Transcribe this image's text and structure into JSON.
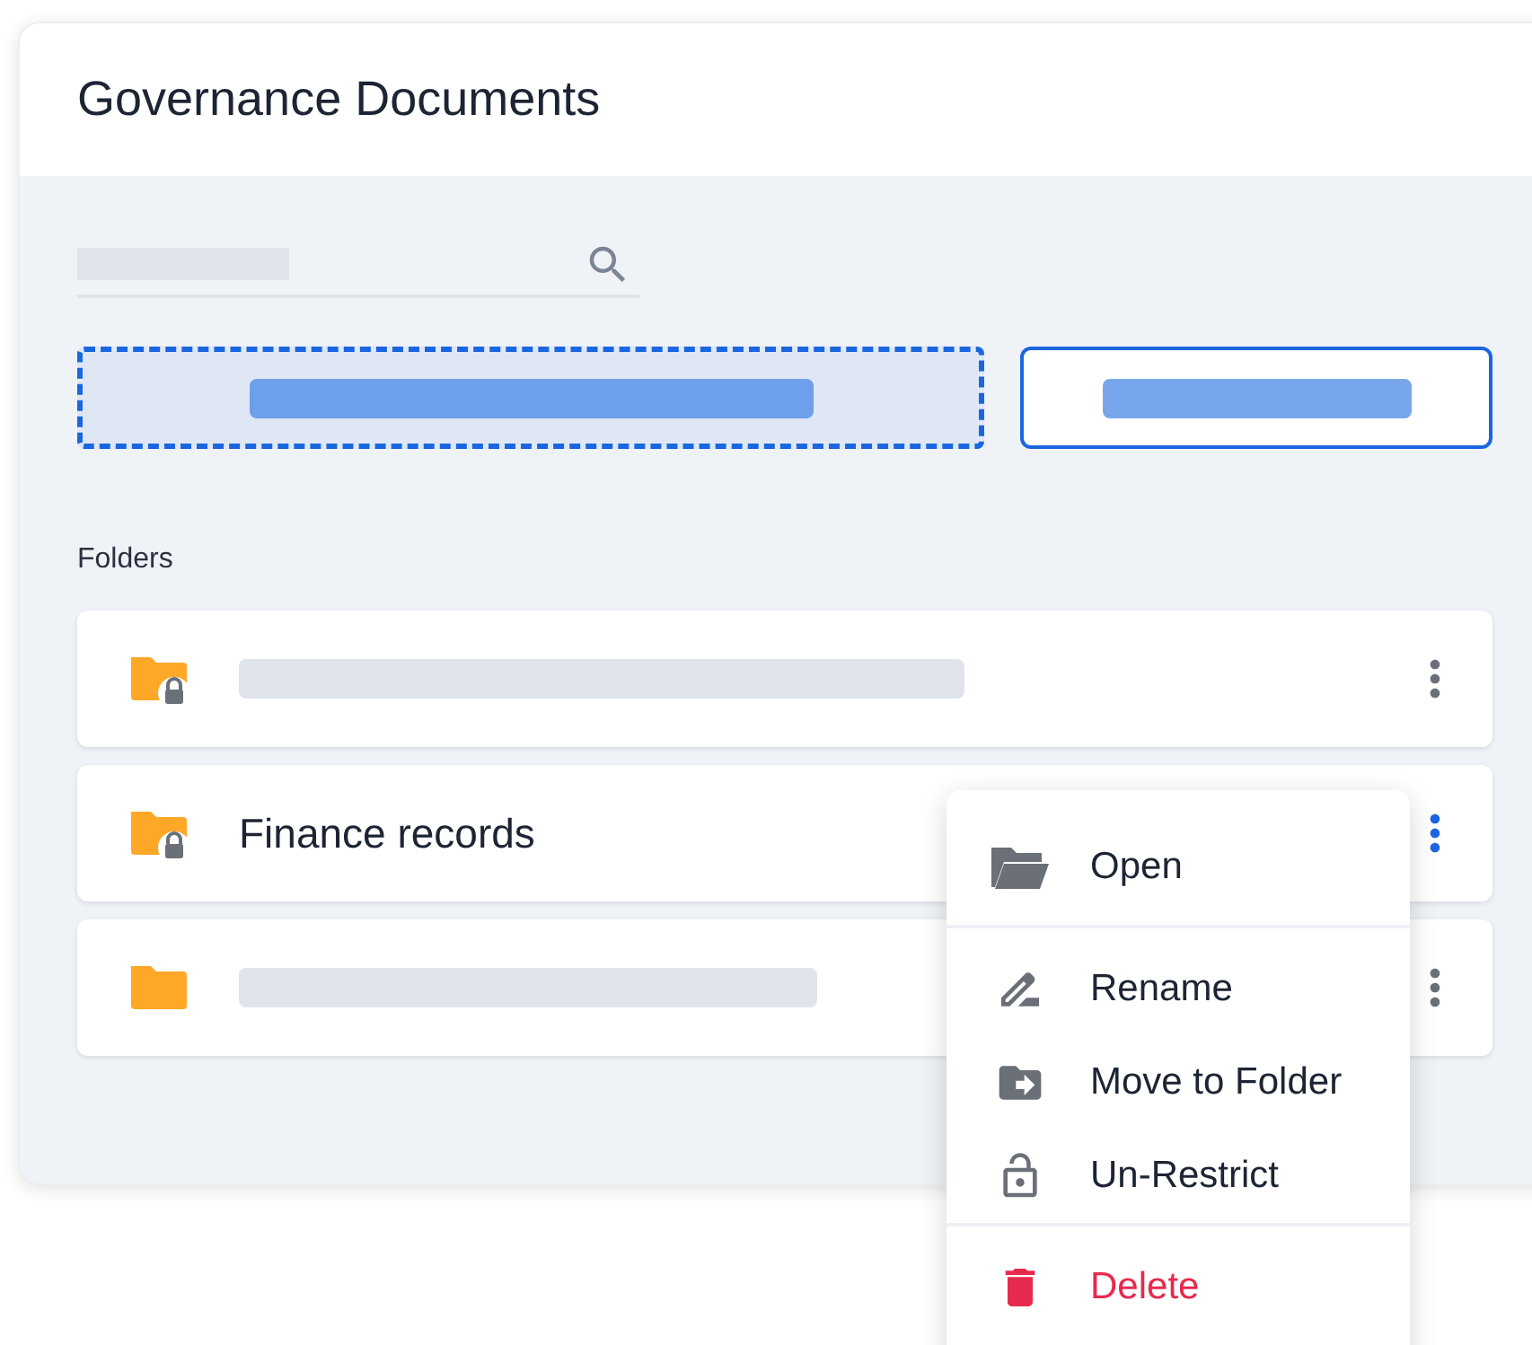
{
  "header": {
    "title": "Governance Documents"
  },
  "folders_heading": "Folders",
  "folders": [
    {
      "restricted": true,
      "menu_open": false
    },
    {
      "name": "Finance records",
      "restricted": true,
      "menu_open": true
    },
    {
      "restricted": false,
      "menu_open": false
    }
  ],
  "menu": {
    "sections": [
      [
        {
          "kind": "open",
          "label": "Open",
          "danger": false
        }
      ],
      [
        {
          "kind": "rename",
          "label": "Rename",
          "danger": false
        },
        {
          "kind": "move",
          "label": "Move to Folder",
          "danger": false
        },
        {
          "kind": "unrestrict",
          "label": "Un-Restrict",
          "danger": false
        }
      ],
      [
        {
          "kind": "delete",
          "label": "Delete",
          "danger": true
        }
      ]
    ]
  }
}
